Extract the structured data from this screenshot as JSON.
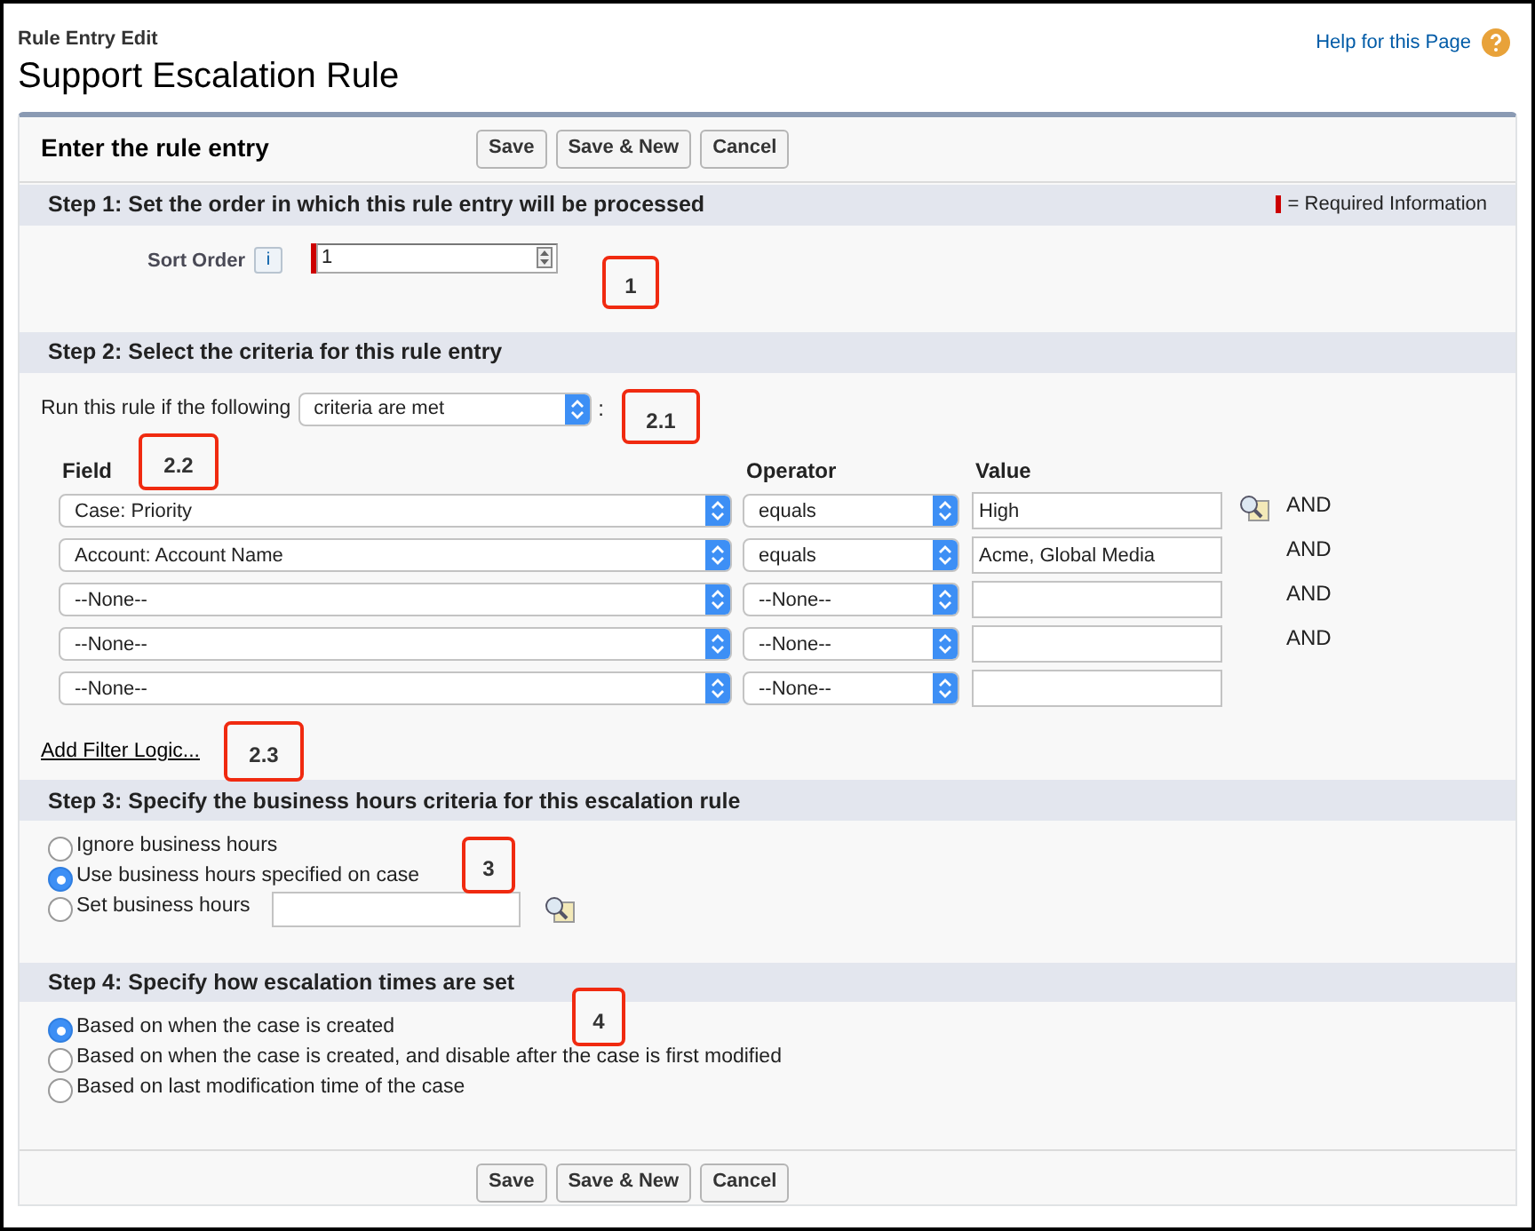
{
  "page": {
    "breadcrumb": "Rule Entry Edit",
    "title": "Support Escalation Rule",
    "help_link": "Help for this Page"
  },
  "form": {
    "heading": "Enter the rule entry",
    "top_buttons": [
      "Save",
      "Save & New",
      "Cancel"
    ],
    "bottom_buttons": [
      "Save",
      "Save & New",
      "Cancel"
    ]
  },
  "step1": {
    "title": "Step 1: Set the order in which this rule entry will be processed",
    "required_legend": "= Required Information",
    "sort_order": {
      "label": "Sort Order",
      "info": "i",
      "value": "1",
      "required": true
    }
  },
  "step2": {
    "title": "Step 2: Select the criteria for this rule entry",
    "run_label": "Run this rule if the following",
    "criteria": "criteria are met",
    "colon": ":",
    "columns": [
      "Field",
      "Operator",
      "Value"
    ],
    "rows": [
      {
        "field": "Case: Priority",
        "operator": "equals",
        "value": "High",
        "lookup": true,
        "conjunction": "AND"
      },
      {
        "field": "Account: Account Name",
        "operator": "equals",
        "value": "Acme, Global Media",
        "lookup": false,
        "conjunction": "AND"
      },
      {
        "field": "--None--",
        "operator": "--None--",
        "lookup": false,
        "conjunction": "AND"
      },
      {
        "field": "--None--",
        "operator": "--None--",
        "lookup": false,
        "conjunction": "AND"
      },
      {
        "field": "--None--",
        "operator": "--None--",
        "lookup": false
      }
    ],
    "filter_logic_link": "Add Filter Logic..."
  },
  "step3": {
    "title": "Step 3: Specify the business hours criteria for this escalation rule",
    "options": [
      {
        "label": "Ignore business hours",
        "selected": false,
        "kind": "radio"
      },
      {
        "label": "Use business hours specified on case",
        "selected": true,
        "kind": "radio"
      },
      {
        "label": "Set business hours",
        "selected": false,
        "kind": "radio_lookup"
      }
    ]
  },
  "step4": {
    "title": "Step 4: Specify how escalation times are set",
    "options": [
      {
        "label": "Based on when the case is created",
        "selected": true
      },
      {
        "label": "Based on when the case is created, and disable after the case is first modified",
        "selected": false
      },
      {
        "label": "Based on last modification time of the case",
        "selected": false
      }
    ]
  },
  "callouts": [
    {
      "label": "1"
    },
    {
      "label": "2.1"
    },
    {
      "label": "2.2"
    },
    {
      "label": "2.3"
    },
    {
      "label": "3"
    },
    {
      "label": "4"
    }
  ]
}
